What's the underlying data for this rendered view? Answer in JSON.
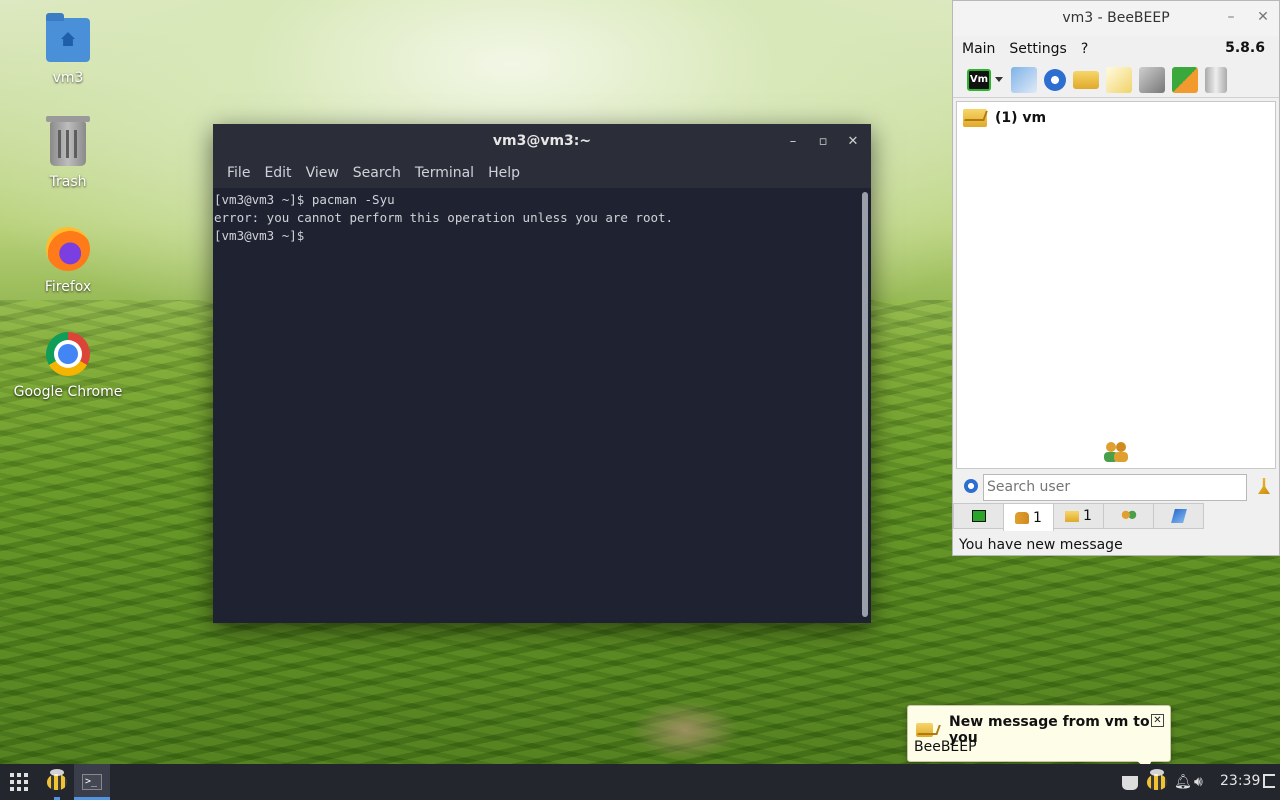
{
  "desktop": {
    "icons": [
      {
        "label": "vm3",
        "icon": "home-folder-icon"
      },
      {
        "label": "Trash",
        "icon": "trash-icon"
      },
      {
        "label": "Firefox",
        "icon": "firefox-icon"
      },
      {
        "label": "Google Chrome",
        "icon": "chrome-icon"
      }
    ]
  },
  "terminal": {
    "title": "vm3@vm3:~",
    "controls": {
      "minimize": "–",
      "maximize": "▫",
      "close": "✕"
    },
    "menu": [
      "File",
      "Edit",
      "View",
      "Search",
      "Terminal",
      "Help"
    ],
    "lines": [
      "[vm3@vm3 ~]$ pacman -Syu",
      "error: you cannot perform this operation unless you are root.",
      "[vm3@vm3 ~]$ "
    ]
  },
  "beebeep": {
    "title": "vm3 - BeeBEEP",
    "controls": {
      "minimize": "–",
      "close": "✕"
    },
    "menu": [
      "Main",
      "Settings",
      "?"
    ],
    "version": "5.8.6",
    "toolbar_icons": [
      "vm-status-icon",
      "profile-edit-icon",
      "network-icon",
      "new-chat-icon",
      "compose-icon",
      "tools-icon",
      "update-icon",
      "trash-icon"
    ],
    "toolbar_status_label": "Vm",
    "users": [
      {
        "label": "(1) vm"
      }
    ],
    "search": {
      "placeholder": "Search user",
      "value": ""
    },
    "tabs": [
      {
        "label": "",
        "icon": "screen-icon"
      },
      {
        "label": "1",
        "icon": "users-icon"
      },
      {
        "label": "1",
        "icon": "chats-icon"
      },
      {
        "label": "",
        "icon": "groups-icon"
      },
      {
        "label": "",
        "icon": "files-icon"
      }
    ],
    "status": "You have new message"
  },
  "notification": {
    "title": "New message from vm to you",
    "body": "BeeBEEP",
    "close": "✕"
  },
  "taskbar": {
    "clock": "23:39",
    "tray_icons": [
      "coffee-icon",
      "beebeep-tray-icon",
      "bell-icon",
      "volume-icon",
      "logout-icon"
    ]
  },
  "colors": {
    "terminal_bg": "#1f2230",
    "titlebar_bg": "#2b2e39",
    "taskbar_bg": "#24262e",
    "accent": "#5294e2",
    "notification_bg": "#fdfde8"
  }
}
